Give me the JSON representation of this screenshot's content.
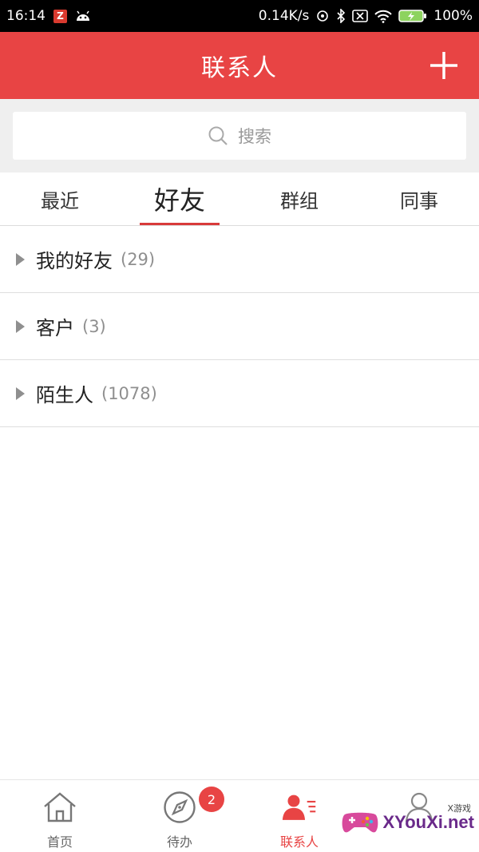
{
  "status_bar": {
    "time": "16:14",
    "speed": "0.14K/s",
    "battery": "100%"
  },
  "header": {
    "title": "联系人"
  },
  "search": {
    "placeholder": "搜索"
  },
  "tabs": [
    {
      "label": "最近",
      "active": false
    },
    {
      "label": "好友",
      "active": true
    },
    {
      "label": "群组",
      "active": false
    },
    {
      "label": "同事",
      "active": false
    }
  ],
  "groups": [
    {
      "name": "我的好友",
      "count": "(29)"
    },
    {
      "name": "客户",
      "count": "(3)"
    },
    {
      "name": "陌生人",
      "count": "(1078)"
    }
  ],
  "bottom_nav": [
    {
      "label": "首页",
      "icon": "home-icon",
      "active": false
    },
    {
      "label": "待办",
      "icon": "compass-icon",
      "active": false,
      "badge": "2"
    },
    {
      "label": "联系人",
      "icon": "contacts-icon",
      "active": true
    },
    {
      "label": "",
      "icon": "profile-icon",
      "active": false
    }
  ],
  "watermark": {
    "text": "XYouXi.net",
    "sub": "X游戏"
  },
  "colors": {
    "accent": "#e84444",
    "underline": "#d83a3a"
  }
}
